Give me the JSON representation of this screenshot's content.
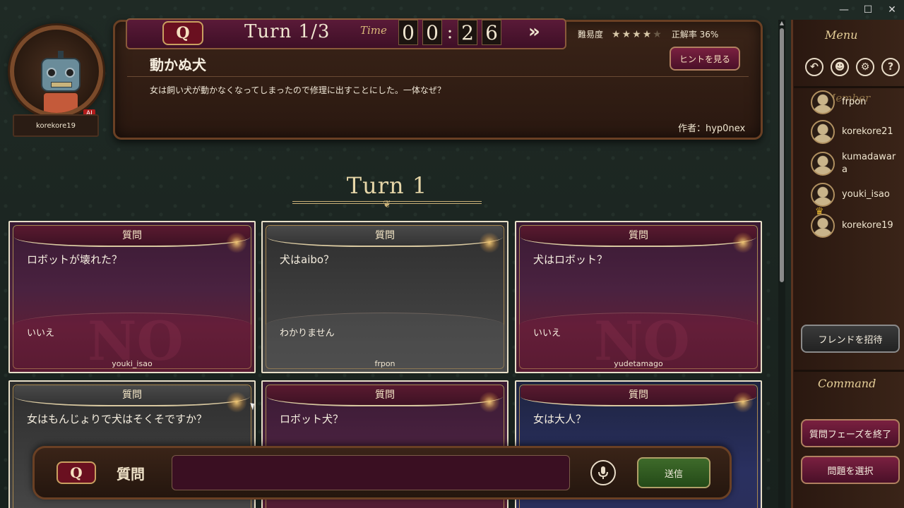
{
  "window": {
    "minimize": "—",
    "maximize": "☐",
    "close": "✕"
  },
  "player": {
    "name": "korekore19",
    "badge": "AI"
  },
  "question": {
    "icon": "Q",
    "turn": "Turn 1/3",
    "time_label": "Time",
    "time_digits": [
      "0",
      "0",
      "2",
      "6"
    ],
    "skip": "»",
    "difficulty_label": "難易度",
    "difficulty_stars": 4,
    "difficulty_max": 5,
    "accuracy_label": "正解率 36%",
    "hint_button": "ヒントを見る",
    "title": "動かぬ犬",
    "text": "女は飼い犬が動かなくなってしまったので修理に出すことにした。一体なぜ？",
    "author": "作者：hyp0nex"
  },
  "turn_heading": "Turn 1",
  "cards": [
    {
      "header": "質問",
      "question": "ロボットが壊れた？",
      "answer": "いいえ",
      "author": "youki_isao",
      "style": "purple",
      "stamp": "NO"
    },
    {
      "header": "質問",
      "question": "犬はaibo？",
      "answer": "わかりません",
      "author": "frpon",
      "style": "gray",
      "stamp": ""
    },
    {
      "header": "質問",
      "question": "犬はロボット？",
      "answer": "いいえ",
      "author": "yudetamago",
      "style": "purple",
      "stamp": "NO"
    },
    {
      "header": "質問",
      "question": "女はもんじょりで犬はそくそですか？",
      "answer": "",
      "author": "",
      "style": "gray",
      "stamp": ""
    },
    {
      "header": "質問",
      "question": "ロボット犬？",
      "answer": "",
      "author": "",
      "style": "purple",
      "stamp": ""
    },
    {
      "header": "質問",
      "question": "女は大人？",
      "answer": "",
      "author": "",
      "style": "navy",
      "stamp": ""
    }
  ],
  "input": {
    "icon": "Q",
    "label": "質問",
    "value": "",
    "send": "送信"
  },
  "sidebar": {
    "menu_title": "Menu",
    "member_title": "Member",
    "members": [
      "frpon",
      "korekore21",
      "kumadawara",
      "youki_isao",
      "korekore19"
    ],
    "invite_button": "フレンドを招待",
    "command_title": "Command",
    "end_phase_button": "質問フェーズを終了",
    "select_problem_button": "問題を選択"
  }
}
